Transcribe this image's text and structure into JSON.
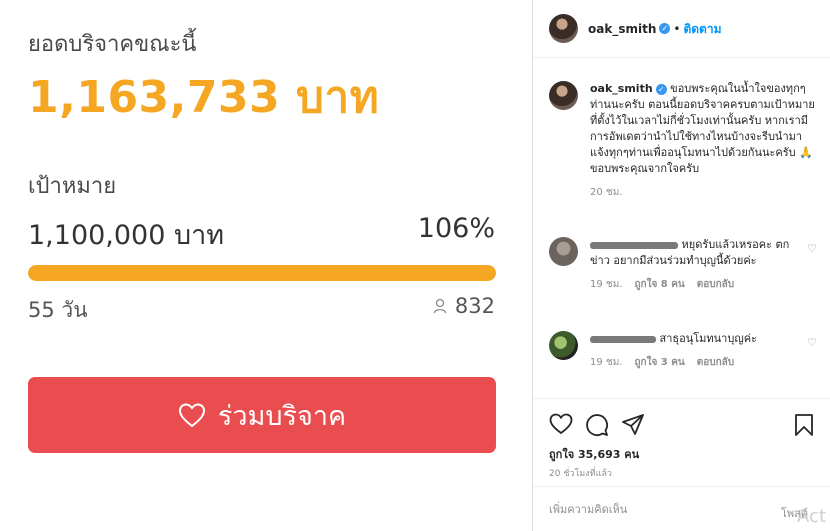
{
  "donation": {
    "title": "ยอดบริจาคขณะนี้",
    "amount": "1,163,733 บาท",
    "goal_label": "เป้าหมาย",
    "goal": "1,100,000 บาท",
    "percent": "106%",
    "progress_fraction": 1.0,
    "days": "55 วัน",
    "backers": "832",
    "donate_label": "ร่วมบริจาค",
    "accent_color": "#f5a623",
    "button_color": "#ea4d4f"
  },
  "post": {
    "username": "oak_smith",
    "dot": "•",
    "follow_label": "ติดตาม",
    "caption": "ขอบพระคุณในน้ำใจของทุกๆท่านนะครับ ตอนนี้ยอดบริจาคครบตามเป้าหมายที่ตั้งไว้ในเวลาไม่กี่ชั่วโมงเท่านั้นครับ หากเรามีการอัพเดตว่านำไปใช้ทางไหนบ้างจะรีบนำมาแจ้งทุกๆท่านเพื่ออนุโมทนาไปด้วยกันนะครับ 🙏 ขอบพระคุณจากใจครับ",
    "caption_time": "20 ชม.",
    "comments": [
      {
        "text": "หยุดรับแล้วเหรอคะ ตกข่าว อยากมีส่วนร่วมทำบุญนี้ด้วยค่ะ",
        "time": "19 ชม.",
        "likes": "ถูกใจ 8 คน",
        "reply": "ตอบกลับ"
      },
      {
        "text": "สาธุอนุโมทนาบุญค่ะ",
        "time": "19 ชม.",
        "likes": "ถูกใจ 3 คน",
        "reply": "ตอบกลับ"
      }
    ],
    "like_count": "ถูกใจ 35,693 คน",
    "posted_ago": "20 ชั่วโมงที่แล้ว",
    "add_comment_placeholder": "เพิ่มความคิดเห็น",
    "post_label": "โพสต์",
    "watermark": "Act"
  }
}
